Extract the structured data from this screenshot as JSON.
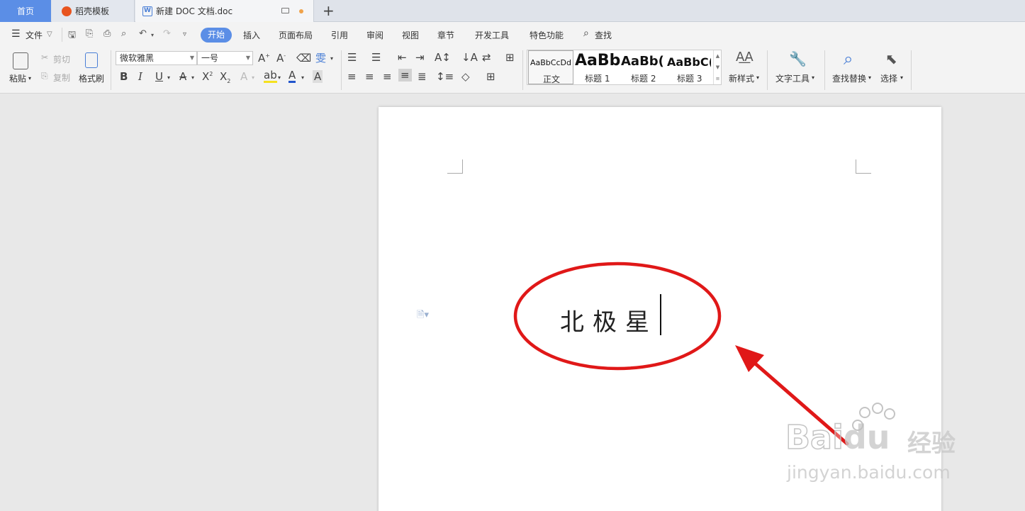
{
  "tabs": {
    "home": "首页",
    "template": "稻壳模板",
    "document": "新建 DOC 文档.doc",
    "add": "+"
  },
  "menu": {
    "file": "文件",
    "items": [
      "开始",
      "插入",
      "页面布局",
      "引用",
      "审阅",
      "视图",
      "章节",
      "开发工具",
      "特色功能"
    ],
    "search": "查找"
  },
  "ribbon": {
    "paste": "粘贴",
    "cut": "剪切",
    "copy": "复制",
    "format_painter": "格式刷",
    "font_name": "微软雅黑",
    "font_size": "一号",
    "styles": [
      {
        "preview": "AaBbCcDd",
        "label": "正文"
      },
      {
        "preview": "AaBb",
        "label": "标题 1"
      },
      {
        "preview": "AaBb(",
        "label": "标题 2"
      },
      {
        "preview": "AaBbC(",
        "label": "标题 3"
      }
    ],
    "new_style": "新样式",
    "text_tools": "文字工具",
    "find_replace": "查找替换",
    "select": "选择"
  },
  "document": {
    "text": "北极星"
  },
  "watermark": {
    "brand": "Bai",
    "brand_tail": "du",
    "product": "经验",
    "url": "jingyan.baidu.com"
  },
  "colors": {
    "accent": "#5b8ee6",
    "annotation": "#e01818"
  }
}
